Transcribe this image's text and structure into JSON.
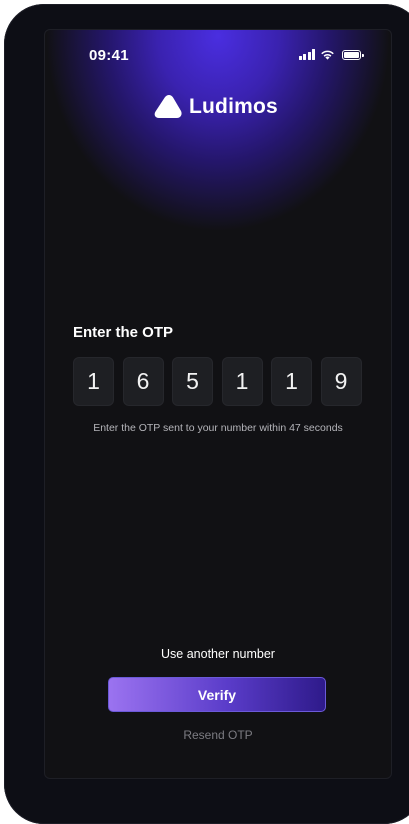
{
  "status_bar": {
    "time": "09:41",
    "icons": [
      "signal-icon",
      "wifi-icon",
      "battery-icon"
    ]
  },
  "brand": {
    "name": "Ludimos",
    "icon": "ludimos-logo-icon"
  },
  "otp": {
    "title": "Enter the OTP",
    "digits": [
      "1",
      "6",
      "5",
      "1",
      "1",
      "9"
    ],
    "hint": "Enter the OTP sent to your number within 47 seconds"
  },
  "actions": {
    "other_number": "Use another number",
    "verify": "Verify",
    "resend": "Resend OTP"
  },
  "colors": {
    "background": "#111114",
    "accent_start": "#9b73f0",
    "accent_end": "#2e1a8a",
    "glow": "#4a2ee0",
    "input_box": "#1e1f23"
  }
}
